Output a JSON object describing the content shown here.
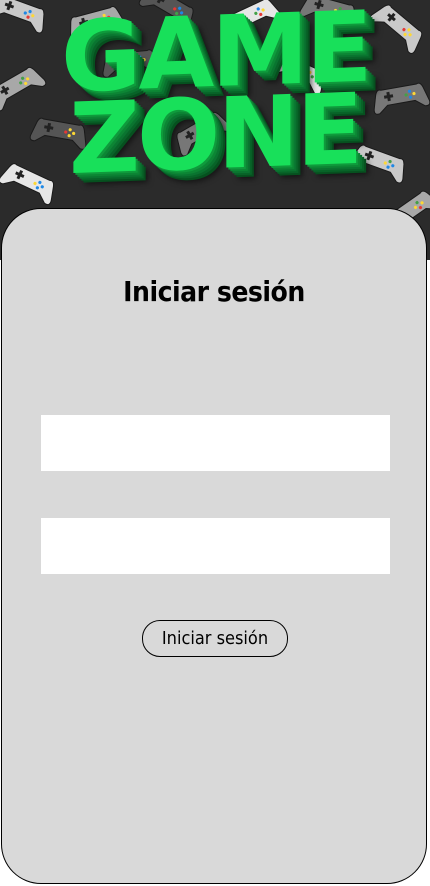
{
  "banner": {
    "logo_line1": "GAME",
    "logo_line2": "ZONE",
    "logo_color": "#18e05a",
    "background_color": "#2b2b2b",
    "pattern_icon": "gamepad-icon"
  },
  "login": {
    "title": "Iniciar sesión",
    "username_placeholder": "",
    "password_placeholder": "",
    "submit_label": "Iniciar sesión"
  },
  "colors": {
    "card_background": "#d9d9d9",
    "field_background": "#ffffff"
  }
}
